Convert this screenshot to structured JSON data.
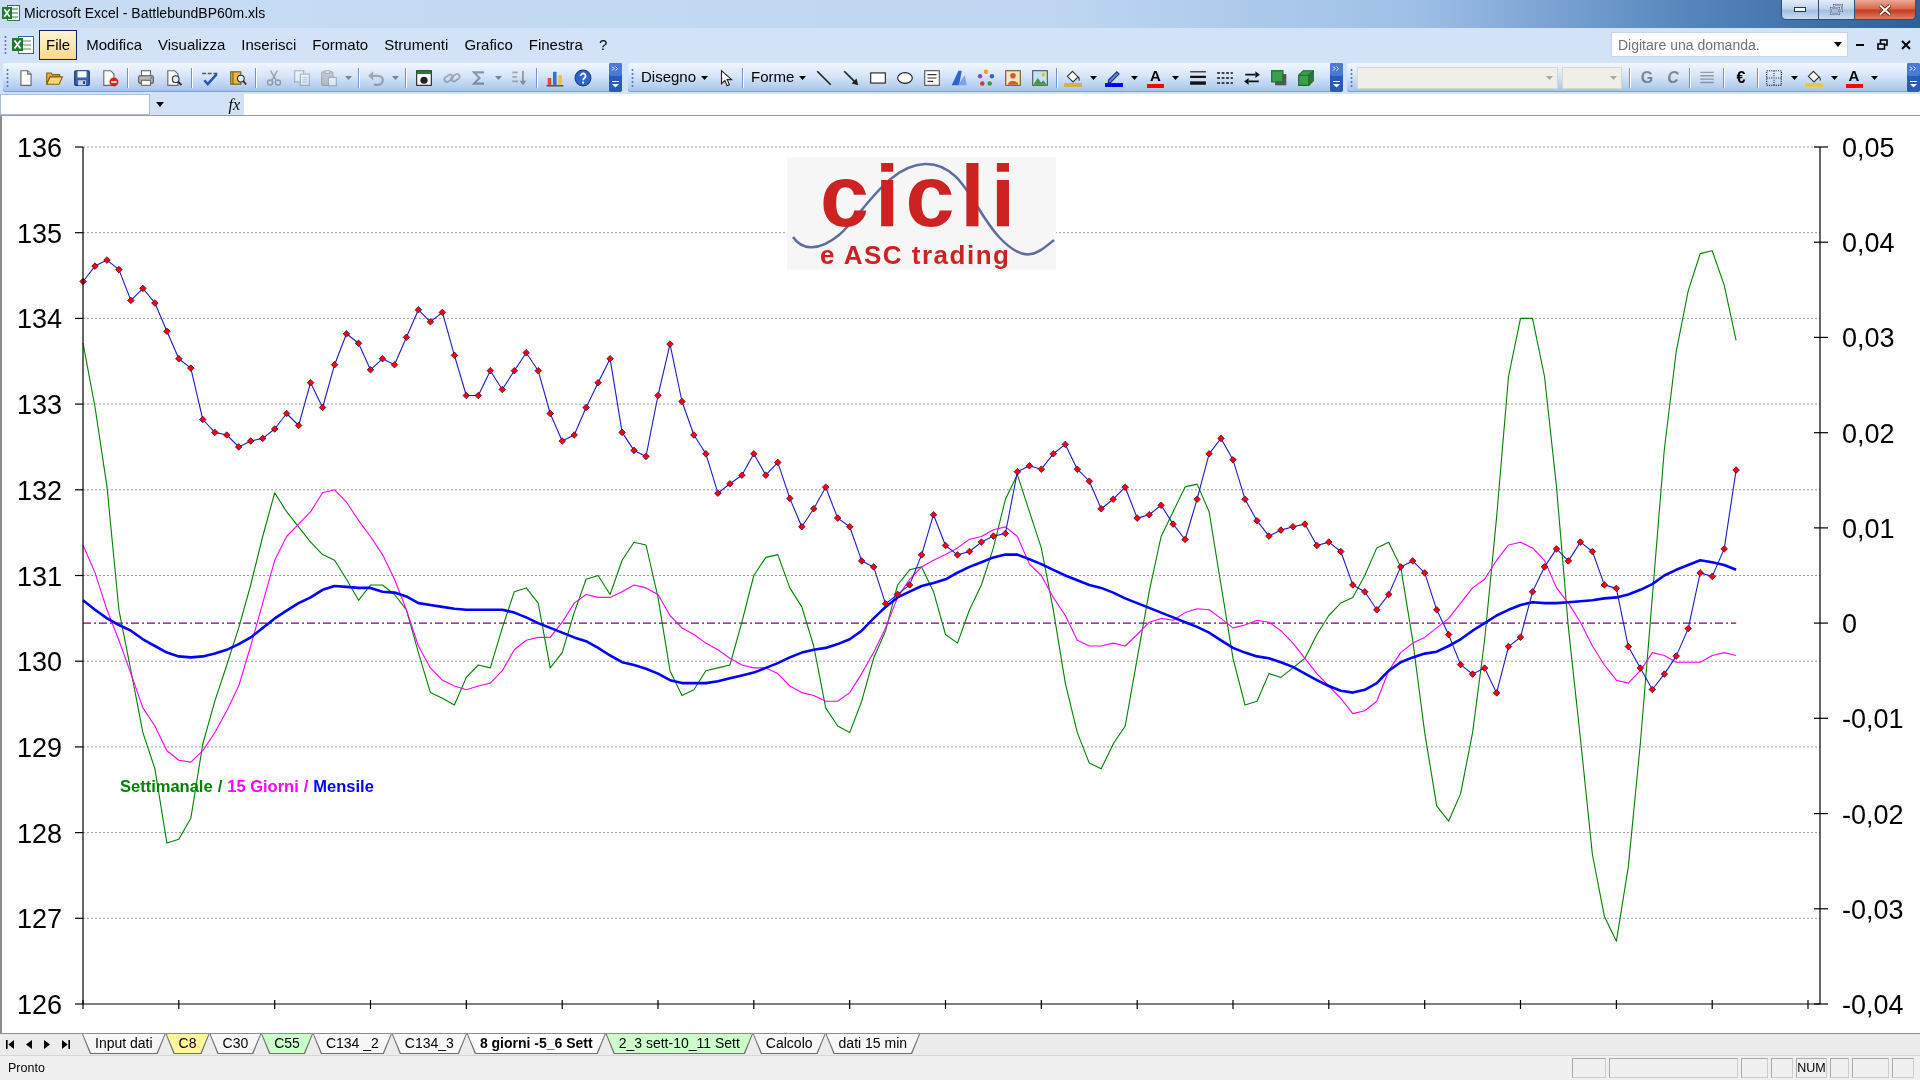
{
  "window": {
    "title": "Microsoft Excel - BattlebundBP60m.xls"
  },
  "menu_bar": {
    "items": [
      {
        "label": "File",
        "selected": true
      },
      {
        "label": "Modifica",
        "selected": false
      },
      {
        "label": "Visualizza",
        "selected": false
      },
      {
        "label": "Inserisci",
        "selected": false
      },
      {
        "label": "Formato",
        "selected": false
      },
      {
        "label": "Strumenti",
        "selected": false
      },
      {
        "label": "Grafico",
        "selected": false
      },
      {
        "label": "Finestra",
        "selected": false
      },
      {
        "label": "?",
        "selected": false
      }
    ],
    "help_box": {
      "placeholder": "Digitare una domanda."
    }
  },
  "toolbars": [
    {
      "groups": [
        [
          {
            "kind": "new",
            "disabled": false
          },
          {
            "kind": "open",
            "disabled": false
          },
          {
            "kind": "save",
            "disabled": false
          },
          {
            "kind": "permission",
            "disabled": false
          }
        ],
        [
          {
            "kind": "print",
            "disabled": false
          },
          {
            "kind": "print_preview",
            "disabled": false
          }
        ],
        [
          {
            "kind": "spelling",
            "disabled": false
          },
          {
            "kind": "research",
            "disabled": false
          }
        ],
        [
          {
            "kind": "cut",
            "disabled": true
          },
          {
            "kind": "copy",
            "disabled": true
          },
          {
            "kind": "paste",
            "disabled": true,
            "dropdown": true
          }
        ],
        [
          {
            "kind": "undo",
            "disabled": true,
            "dropdown": true
          }
        ],
        [
          {
            "kind": "euro_conversion",
            "disabled": false
          },
          {
            "kind": "hyperlink",
            "disabled": true
          },
          {
            "kind": "autosum",
            "disabled": true,
            "dropdown": true
          },
          {
            "kind": "sort_ascending",
            "disabled": true
          }
        ],
        [
          {
            "kind": "chart_wizard",
            "disabled": false
          },
          {
            "kind": "help",
            "disabled": false
          }
        ]
      ]
    },
    {
      "groups": [
        [
          {
            "kind": "menu",
            "label": "Disegno",
            "disabled": false
          },
          {
            "kind": "select_objects",
            "disabled": false
          }
        ],
        [
          {
            "kind": "menu",
            "label": "Forme",
            "disabled": false
          },
          {
            "kind": "line",
            "disabled": false
          },
          {
            "kind": "arrow",
            "disabled": false
          },
          {
            "kind": "rectangle",
            "disabled": false
          },
          {
            "kind": "oval",
            "disabled": false
          },
          {
            "kind": "text_box",
            "disabled": false
          },
          {
            "kind": "wordart",
            "disabled": false
          },
          {
            "kind": "diagram",
            "disabled": false
          },
          {
            "kind": "clip_art",
            "disabled": false
          },
          {
            "kind": "picture",
            "disabled": false
          }
        ],
        [
          {
            "kind": "fill_color",
            "disabled": false,
            "dropdown": true,
            "color": "#c9b25a"
          },
          {
            "kind": "line_color",
            "disabled": false,
            "dropdown": true,
            "color": "#0000ff"
          },
          {
            "kind": "font_color",
            "label": "A",
            "disabled": false,
            "dropdown": true,
            "color": "#ff0000"
          },
          {
            "kind": "line_style",
            "disabled": false
          },
          {
            "kind": "dash_style",
            "disabled": false
          },
          {
            "kind": "arrow_style",
            "disabled": false
          },
          {
            "kind": "shadow",
            "disabled": false
          },
          {
            "kind": "three_d",
            "disabled": false
          }
        ]
      ]
    },
    {
      "groups": [
        [
          {
            "kind": "font_name",
            "disabled": true
          },
          {
            "kind": "font_size",
            "disabled": true
          }
        ],
        [
          {
            "kind": "bold",
            "label": "G",
            "disabled": true
          },
          {
            "kind": "italic",
            "label": "C",
            "disabled": true
          }
        ],
        [
          {
            "kind": "justify",
            "disabled": true
          }
        ],
        [
          {
            "kind": "euro",
            "label": "€",
            "disabled": false
          }
        ],
        [
          {
            "kind": "borders",
            "disabled": false,
            "dropdown": true
          },
          {
            "kind": "fill_color",
            "disabled": false,
            "dropdown": true,
            "color": "#e8c83c"
          },
          {
            "kind": "font_color",
            "label": "A",
            "disabled": false,
            "dropdown": true,
            "color": "#ff0000"
          }
        ]
      ]
    }
  ],
  "formula_bar": {
    "function_button": "fx"
  },
  "chart": {
    "logo": {
      "title": "cicli",
      "subtitle": "e ASC trading"
    },
    "legend_separators": [
      "/",
      "/"
    ],
    "chart_data": {
      "type": "line",
      "grid": true,
      "ylim": [
        126,
        136
      ],
      "yticks": [
        136,
        135,
        134,
        133,
        132,
        131,
        130,
        129,
        128,
        127,
        126
      ],
      "y2lim": [
        -0.04,
        0.05
      ],
      "y2ticks": [
        {
          "value": 0.05,
          "label": "0,05"
        },
        {
          "value": 0.04,
          "label": "0,04"
        },
        {
          "value": 0.03,
          "label": "0,03"
        },
        {
          "value": 0.02,
          "label": "0,02"
        },
        {
          "value": 0.01,
          "label": "0,01"
        },
        {
          "value": 0,
          "label": "0"
        },
        {
          "value": -0.01,
          "label": "-0,01"
        },
        {
          "value": -0.02,
          "label": "-0,02"
        },
        {
          "value": -0.03,
          "label": "-0,03"
        },
        {
          "value": -0.04,
          "label": "-0,04"
        }
      ],
      "ref_lines": [
        {
          "value": 0,
          "axis": "y2",
          "color": "#800080"
        }
      ],
      "series": [
        {
          "name": "Settimanale",
          "color": "#008000",
          "axis": "y2",
          "values": [
            0.0294,
            0.0227,
            0.0143,
            0.0014,
            -0.005,
            -0.0115,
            -0.0153,
            -0.0231,
            -0.0227,
            -0.0205,
            -0.0127,
            -0.0082,
            -0.0044,
            -0.0005,
            0.004,
            0.0091,
            0.0137,
            0.0117,
            0.0101,
            0.0085,
            0.0072,
            0.0066,
            0.0046,
            0.0024,
            0.004,
            0.004,
            0.003,
            0.0014,
            -0.0031,
            -0.0073,
            -0.0079,
            -0.0086,
            -0.0057,
            -0.0044,
            -0.0047,
            -0.0005,
            0.0033,
            0.0037,
            0.0021,
            -0.0047,
            -0.0031,
            0.0011,
            0.0046,
            0.005,
            0.003,
            0.0066,
            0.0085,
            0.0082,
            0.0027,
            -0.005,
            -0.0076,
            -0.007,
            -0.005,
            -0.0047,
            -0.0044,
            0.0001,
            0.005,
            0.0069,
            0.0072,
            0.0037,
            0.0017,
            -0.0024,
            -0.0089,
            -0.0108,
            -0.0115,
            -0.0082,
            -0.0037,
            -0.0008,
            0.004,
            0.0056,
            0.0059,
            0.0033,
            -0.0012,
            -0.0021,
            0.0014,
            0.004,
            0.0079,
            0.013,
            0.0156,
            0.0117,
            0.0079,
            0.0014,
            -0.0063,
            -0.0115,
            -0.0147,
            -0.0153,
            -0.0127,
            -0.0108,
            -0.0037,
            0.0033,
            0.0091,
            0.0117,
            0.0143,
            0.0146,
            0.0117,
            0.004,
            -0.0037,
            -0.0086,
            -0.0082,
            -0.0053,
            -0.0057,
            -0.0047,
            -0.0037,
            -0.0012,
            0.0008,
            0.0021,
            0.0027,
            0.005,
            0.0079,
            0.0085,
            0.0059,
            -0.0018,
            -0.0115,
            -0.0192,
            -0.0208,
            -0.0179,
            -0.0115,
            -0.0018,
            0.0111,
            0.0259,
            0.032,
            0.032,
            0.0259,
            0.0143,
            -0.0005,
            -0.0121,
            -0.0243,
            -0.0308,
            -0.0334,
            -0.0256,
            -0.0127,
            0.0027,
            0.0182,
            0.0285,
            0.0349,
            0.0388,
            0.0391,
            0.0355,
            0.0297,
            null,
            null,
            null,
            null,
            null,
            null,
            null
          ]
        },
        {
          "name": "15 Giorni",
          "color": "#ff00ff",
          "axis": "y2",
          "values": [
            0.0082,
            0.0053,
            0.0014,
            -0.0018,
            -0.0053,
            -0.0089,
            -0.0108,
            -0.0134,
            -0.0144,
            -0.0146,
            -0.0134,
            -0.0115,
            -0.0092,
            -0.0066,
            -0.0024,
            0.0021,
            0.0066,
            0.0091,
            0.0104,
            0.0117,
            0.0137,
            0.014,
            0.0127,
            0.0108,
            0.0091,
            0.0072,
            0.0046,
            0.0014,
            -0.0024,
            -0.0047,
            -0.006,
            -0.0066,
            -0.007,
            -0.0066,
            -0.0063,
            -0.005,
            -0.0028,
            -0.0018,
            -0.0015,
            -0.0015,
            0.0001,
            0.0021,
            0.003,
            0.0027,
            0.0027,
            0.0033,
            0.004,
            0.0037,
            0.003,
            0.0008,
            -0.0005,
            -0.0012,
            -0.0021,
            -0.0028,
            -0.0037,
            -0.0044,
            -0.0047,
            -0.0047,
            -0.0053,
            -0.0066,
            -0.0073,
            -0.0076,
            -0.0082,
            -0.0082,
            -0.0073,
            -0.0053,
            -0.0031,
            -0.0005,
            0.0027,
            0.0046,
            0.0059,
            0.0066,
            0.0072,
            0.0079,
            0.0088,
            0.0091,
            0.0098,
            0.0101,
            0.0091,
            0.0062,
            0.005,
            0.0027,
            0.0008,
            -0.0018,
            -0.0024,
            -0.0024,
            -0.0021,
            -0.0024,
            -0.0012,
            0.0001,
            0.0005,
            0.0003,
            0.0011,
            0.0015,
            0.0014,
            0.0005,
            -0.0005,
            -0.0002,
            0.0003,
            0.0001,
            -0.0008,
            -0.0021,
            -0.0037,
            -0.0053,
            -0.0066,
            -0.0079,
            -0.0095,
            -0.0092,
            -0.0082,
            -0.005,
            -0.0031,
            -0.0021,
            -0.0015,
            -0.0005,
            0.0005,
            0.0021,
            0.0037,
            0.0046,
            0.0066,
            0.0082,
            0.0085,
            0.0079,
            0.0066,
            0.0037,
            0.0021,
            0.0001,
            -0.0024,
            -0.0044,
            -0.006,
            -0.0063,
            -0.005,
            -0.0031,
            -0.0034,
            -0.0041,
            -0.0041,
            -0.0041,
            -0.0034,
            -0.0031,
            -0.0034,
            null,
            null,
            null,
            null,
            null,
            null,
            null
          ]
        },
        {
          "name": "Mensile",
          "color": "#0000ff",
          "axis": "y2",
          "values": [
            0.0024,
            0.0014,
            0.0005,
            -0.0002,
            -0.0008,
            -0.0017,
            -0.0024,
            -0.0031,
            -0.0035,
            -0.0036,
            -0.0035,
            -0.0032,
            -0.0028,
            -0.0022,
            -0.0015,
            -0.0005,
            0.0005,
            0.0013,
            0.0021,
            0.0027,
            0.0035,
            0.0039,
            0.0038,
            0.0037,
            0.0037,
            0.0033,
            0.0032,
            0.0028,
            0.0021,
            0.0019,
            0.0017,
            0.0015,
            0.0014,
            0.0014,
            0.0014,
            0.0014,
            0.0011,
            0.0006,
            0,
            -0.0005,
            -0.001,
            -0.0015,
            -0.0019,
            -0.0026,
            -0.0034,
            -0.0041,
            -0.0044,
            -0.0048,
            -0.0053,
            -0.006,
            -0.0063,
            -0.0063,
            -0.0063,
            -0.0061,
            -0.0058,
            -0.0055,
            -0.0052,
            -0.0047,
            -0.0042,
            -0.0036,
            -0.0031,
            -0.0028,
            -0.0026,
            -0.0022,
            -0.0017,
            -0.0008,
            0.0005,
            0.0017,
            0.0027,
            0.0033,
            0.0039,
            0.0042,
            0.0046,
            0.0053,
            0.0059,
            0.0064,
            0.0069,
            0.0072,
            0.0072,
            0.0067,
            0.0062,
            0.0056,
            0.005,
            0.0045,
            0.004,
            0.0037,
            0.0032,
            0.0026,
            0.0021,
            0.0016,
            0.0011,
            0.0006,
            0.0001,
            -0.0004,
            -0.001,
            -0.0018,
            -0.0026,
            -0.0031,
            -0.0035,
            -0.0037,
            -0.0041,
            -0.0046,
            -0.0053,
            -0.006,
            -0.0066,
            -0.0071,
            -0.0073,
            -0.007,
            -0.0063,
            -0.005,
            -0.0041,
            -0.0036,
            -0.0032,
            -0.003,
            -0.0024,
            -0.0017,
            -0.0008,
            0,
            0.0008,
            0.0014,
            0.0019,
            0.0022,
            0.0021,
            0.0021,
            0.0022,
            0.0023,
            0.0024,
            0.0026,
            0.0027,
            0.003,
            0.0035,
            0.0041,
            0.005,
            0.0056,
            0.0061,
            0.0066,
            0.0064,
            0.0061,
            0.0056,
            null,
            null,
            null,
            null,
            null,
            null,
            null
          ]
        },
        {
          "color": "#1c1cc8",
          "marker": "diamond",
          "values": [
            134.43,
            134.61,
            134.68,
            134.57,
            134.21,
            134.35,
            134.18,
            133.85,
            133.53,
            133.42,
            132.82,
            132.67,
            132.64,
            132.5,
            132.57,
            132.6,
            132.71,
            132.89,
            132.75,
            133.25,
            132.96,
            133.46,
            133.82,
            133.71,
            133.4,
            133.53,
            133.46,
            133.78,
            134.1,
            133.96,
            134.07,
            133.57,
            133.1,
            133.1,
            133.39,
            133.17,
            133.39,
            133.6,
            133.39,
            132.89,
            132.57,
            132.64,
            132.96,
            133.25,
            133.53,
            132.67,
            132.46,
            132.39,
            133.1,
            133.7,
            133.03,
            132.64,
            132.42,
            131.96,
            132.07,
            132.17,
            132.42,
            132.17,
            132.32,
            131.9,
            131.57,
            131.78,
            132.03,
            131.67,
            131.57,
            131.17,
            131.1,
            130.67,
            130.78,
            130.89,
            131.24,
            131.71,
            131.35,
            131.24,
            131.28,
            131.39,
            131.46,
            131.49,
            132.21,
            132.28,
            132.24,
            132.42,
            132.53,
            132.24,
            132.1,
            131.78,
            131.89,
            132.03,
            131.67,
            131.71,
            131.82,
            131.6,
            131.42,
            131.89,
            132.42,
            132.6,
            132.35,
            131.89,
            131.64,
            131.46,
            131.53,
            131.57,
            131.6,
            131.35,
            131.39,
            131.28,
            130.89,
            130.81,
            130.6,
            130.78,
            131.1,
            131.17,
            131.03,
            130.6,
            130.31,
            129.96,
            129.85,
            129.92,
            129.63,
            130.17,
            130.28,
            130.81,
            131.1,
            131.31,
            131.17,
            131.39,
            131.28,
            130.89,
            130.85,
            130.17,
            129.92,
            129.67,
            129.85,
            130.06,
            130.38,
            131.03,
            130.99,
            131.31,
            132.23,
            null,
            null,
            null,
            null,
            null,
            null,
            null
          ]
        }
      ]
    }
  },
  "sheet_tabs": [
    {
      "label": "Input dati",
      "selected": false
    },
    {
      "label": "C8",
      "selected": false,
      "color": "#fff59a"
    },
    {
      "label": "C30",
      "selected": false
    },
    {
      "label": "C55",
      "selected": false,
      "color": "#ccffcc"
    },
    {
      "label": "C134 _2",
      "selected": false
    },
    {
      "label": "C134_3",
      "selected": false
    },
    {
      "label": "8 giorni -5_6 Sett",
      "selected": true
    },
    {
      "label": "2_3 sett-10_11 Sett",
      "selected": false,
      "color": "#ccffcc"
    },
    {
      "label": "Calcolo",
      "selected": false
    },
    {
      "label": "dati 15 min",
      "selected": false
    }
  ],
  "status_bar": {
    "message": "Pronto",
    "panels": [
      {
        "kind": "blank"
      },
      {
        "kind": "blank"
      },
      {
        "kind": "blank"
      },
      {
        "kind": "blank"
      },
      {
        "kind": "indicator",
        "label": "NUM"
      },
      {
        "kind": "blank"
      },
      {
        "kind": "blank"
      },
      {
        "kind": "blank"
      }
    ]
  }
}
